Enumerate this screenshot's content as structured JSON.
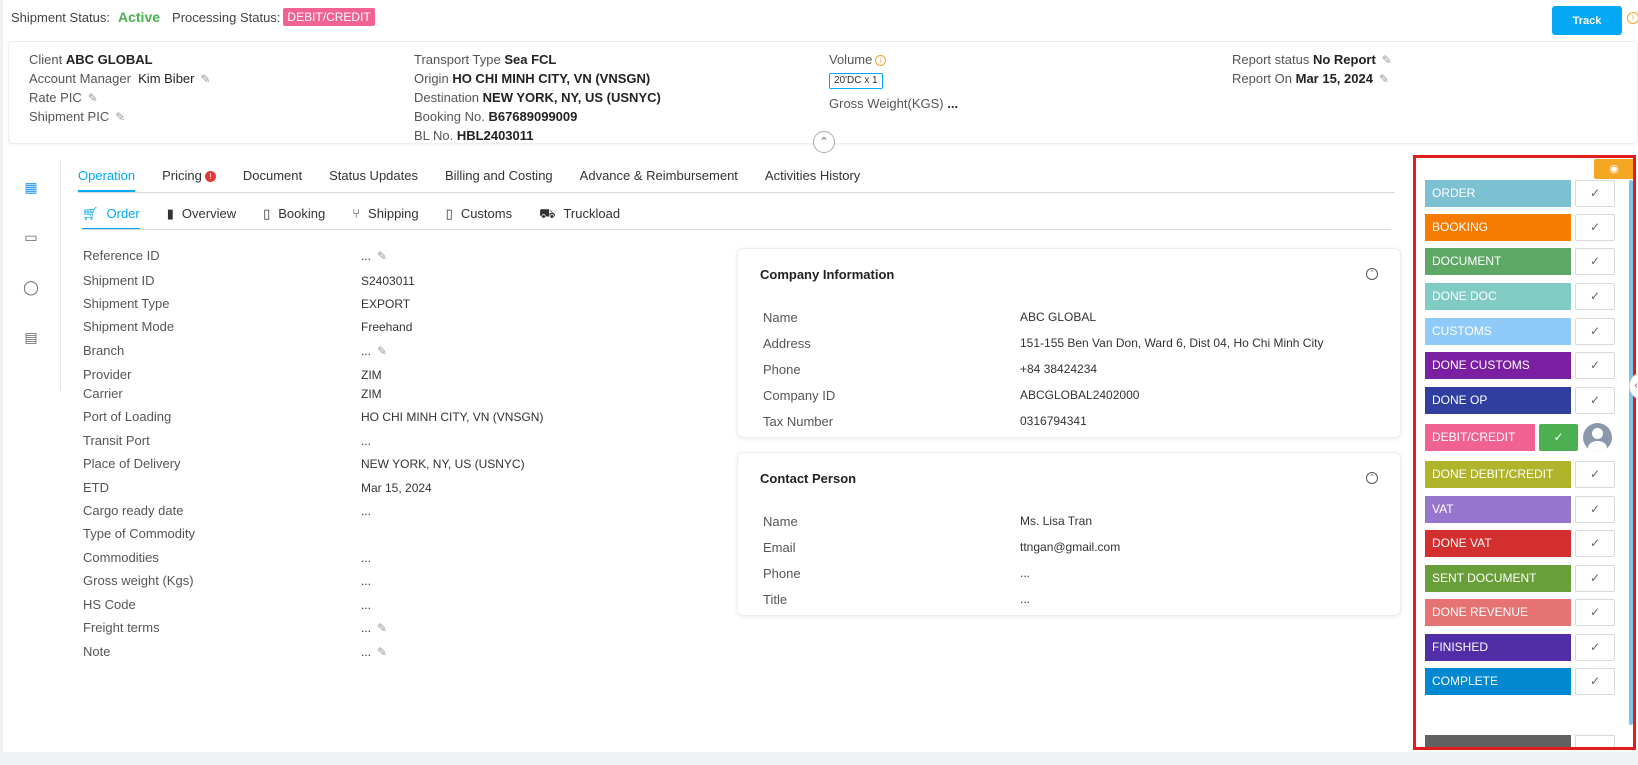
{
  "topbar": {
    "shipment_status_label": "Shipment Status:",
    "shipment_status_value": "Active",
    "processing_status_label": "Processing Status:",
    "processing_status_value": "DEBIT/CREDIT",
    "track_label": "Track"
  },
  "header": {
    "client_label": "Client",
    "client_value": "ABC GLOBAL",
    "account_manager_label": "Account Manager",
    "account_manager_value": "Kim Biber",
    "rate_pic_label": "Rate PIC",
    "shipment_pic_label": "Shipment PIC",
    "transport_type_label": "Transport Type",
    "transport_type_value": "Sea FCL",
    "origin_label": "Origin",
    "origin_value": "HO CHI MINH CITY, VN (VNSGN)",
    "destination_label": "Destination",
    "destination_value": "NEW YORK, NY, US (USNYC)",
    "booking_no_label": "Booking No.",
    "booking_no_value": "B67689099009",
    "bl_no_label": "BL No.",
    "bl_no_value": "HBL2403011",
    "volume_label": "Volume",
    "volume_chip": "20'DC x 1",
    "gross_weight_label": "Gross Weight(KGS)",
    "gross_weight_value": "...",
    "report_status_label": "Report status",
    "report_status_value": "No Report",
    "report_on_label": "Report On",
    "report_on_value": "Mar 15, 2024"
  },
  "tabs": [
    {
      "label": "Operation"
    },
    {
      "label": "Pricing"
    },
    {
      "label": "Document"
    },
    {
      "label": "Status Updates"
    },
    {
      "label": "Billing and Costing"
    },
    {
      "label": "Advance & Reimbursement"
    },
    {
      "label": "Activities History"
    }
  ],
  "subtabs": [
    {
      "label": "Order"
    },
    {
      "label": "Overview"
    },
    {
      "label": "Booking"
    },
    {
      "label": "Shipping"
    },
    {
      "label": "Customs"
    },
    {
      "label": "Truckload"
    }
  ],
  "order_fields": [
    {
      "label": "Reference ID",
      "value": "..."
    },
    {
      "label": "Shipment ID",
      "value": "S2403011"
    },
    {
      "label": "Shipment Type",
      "value": "EXPORT"
    },
    {
      "label": "Shipment Mode",
      "value": "Freehand"
    },
    {
      "label": "Branch",
      "value": "..."
    },
    {
      "label": "Provider",
      "value": "ZIM"
    },
    {
      "label": "Carrier",
      "value": "ZIM"
    },
    {
      "label": "Port of Loading",
      "value": "HO CHI MINH CITY, VN (VNSGN)"
    },
    {
      "label": "Transit Port",
      "value": "..."
    },
    {
      "label": "Place of Delivery",
      "value": "NEW YORK, NY, US (USNYC)"
    },
    {
      "label": "ETD",
      "value": "Mar 15, 2024"
    },
    {
      "label": "Cargo ready date",
      "value": "..."
    },
    {
      "label": "Type of Commodity",
      "value": ""
    },
    {
      "label": "Commodities",
      "value": "..."
    },
    {
      "label": "Gross weight (Kgs)",
      "value": "..."
    },
    {
      "label": "HS Code",
      "value": "..."
    },
    {
      "label": "Freight terms",
      "value": "..."
    },
    {
      "label": "Note",
      "value": "..."
    }
  ],
  "company": {
    "title": "Company Information",
    "rows": [
      {
        "label": "Name",
        "value": "ABC GLOBAL"
      },
      {
        "label": "Address",
        "value": "151-155 Ben Van Don, Ward 6, Dist 04, Ho Chi Minh City"
      },
      {
        "label": "Phone",
        "value": "+84 38424234"
      },
      {
        "label": "Company ID",
        "value": "ABCGLOBAL2402000"
      },
      {
        "label": "Tax Number",
        "value": "0316794341"
      }
    ]
  },
  "contact": {
    "title": "Contact Person",
    "rows": [
      {
        "label": "Name",
        "value": "Ms. Lisa Tran"
      },
      {
        "label": "Email",
        "value": "ttngan@gmail.com"
      },
      {
        "label": "Phone",
        "value": "..."
      },
      {
        "label": "Title",
        "value": "..."
      }
    ]
  },
  "statuses": [
    {
      "label": "ORDER",
      "color": "#7cc1d1"
    },
    {
      "label": "BOOKING",
      "color": "#f57c00"
    },
    {
      "label": "DOCUMENT",
      "color": "#5ea866"
    },
    {
      "label": "DONE DOC",
      "color": "#80cbc4"
    },
    {
      "label": "CUSTOMS",
      "color": "#90caf9"
    },
    {
      "label": "DONE CUSTOMS",
      "color": "#7b1fa2"
    },
    {
      "label": "DONE OP",
      "color": "#303f9f"
    },
    {
      "label": "DEBIT/CREDIT",
      "color": "#f06292"
    },
    {
      "label": "DONE DEBIT/CREDIT",
      "color": "#afb42b"
    },
    {
      "label": "VAT",
      "color": "#9575cd"
    },
    {
      "label": "DONE VAT",
      "color": "#d32f2f"
    },
    {
      "label": "SENT DOCUMENT",
      "color": "#689f38"
    },
    {
      "label": "DONE REVENUE",
      "color": "#e57373"
    },
    {
      "label": "FINISHED",
      "color": "#512da8"
    },
    {
      "label": "COMPLETE",
      "color": "#0288d1"
    }
  ]
}
